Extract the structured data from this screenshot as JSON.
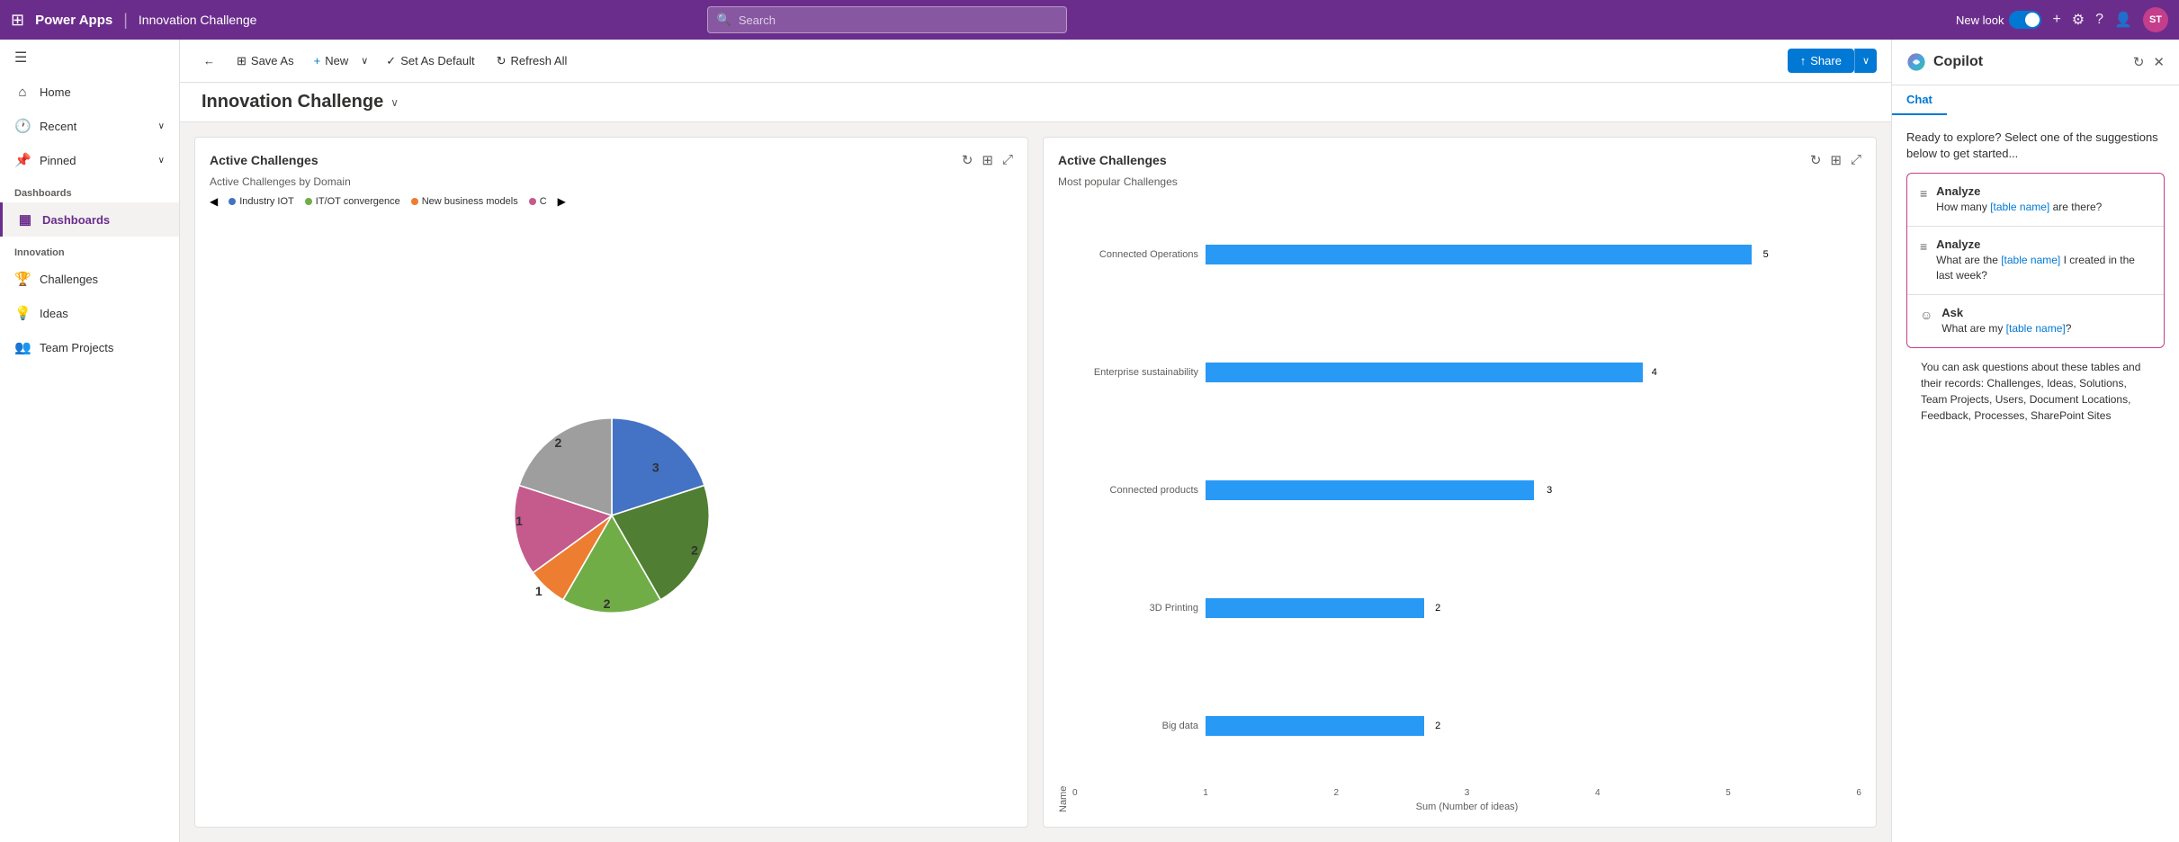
{
  "topNav": {
    "brand": "Power Apps",
    "divider": "|",
    "appName": "Innovation Challenge",
    "searchPlaceholder": "Search",
    "newLook": "New look",
    "icons": {
      "plus": "+",
      "settings": "⚙",
      "help": "?",
      "person": "👤"
    },
    "avatar": "ST"
  },
  "sidebar": {
    "hamburger": "☰",
    "items": [
      {
        "id": "home",
        "label": "Home",
        "icon": "⌂"
      },
      {
        "id": "recent",
        "label": "Recent",
        "icon": "🕐",
        "chevron": "∨"
      },
      {
        "id": "pinned",
        "label": "Pinned",
        "icon": "📌",
        "chevron": "∨"
      }
    ],
    "sections": [
      {
        "label": "Dashboards",
        "items": [
          {
            "id": "dashboards",
            "label": "Dashboards",
            "icon": "▦",
            "active": true
          }
        ]
      },
      {
        "label": "Innovation",
        "items": [
          {
            "id": "challenges",
            "label": "Challenges",
            "icon": "🏆"
          },
          {
            "id": "ideas",
            "label": "Ideas",
            "icon": "💡"
          },
          {
            "id": "team-projects",
            "label": "Team Projects",
            "icon": "👥"
          }
        ]
      }
    ]
  },
  "toolbar": {
    "back": "←",
    "saveAs": "Save As",
    "new": "New",
    "setAsDefault": "Set As Default",
    "refreshAll": "Refresh All",
    "share": "Share"
  },
  "pageTitle": "Innovation Challenge",
  "pieChart": {
    "title": "Active Challenges",
    "subtitle": "Active Challenges by Domain",
    "legend": [
      {
        "label": "Industry IOT",
        "color": "#4472c4"
      },
      {
        "label": "IT/OT convergence",
        "color": "#70ad47"
      },
      {
        "label": "New business models",
        "color": "#ed7d31"
      },
      {
        "label": "C",
        "color": "#c55a8c"
      }
    ],
    "slices": [
      {
        "label": "3",
        "color": "#4472c4",
        "value": 3,
        "startAngle": 0,
        "endAngle": 108
      },
      {
        "label": "2",
        "color": "#70ad47",
        "value": 2,
        "startAngle": 108,
        "endAngle": 216
      },
      {
        "label": "2",
        "color": "#70ad47",
        "value": 2,
        "startAngle": 108,
        "endAngle": 180
      },
      {
        "label": "1",
        "color": "#ed7d31",
        "value": 1,
        "startAngle": 216,
        "endAngle": 252
      },
      {
        "label": "1",
        "color": "#c55a8c",
        "value": 1,
        "startAngle": 252,
        "endAngle": 288
      },
      {
        "label": "2",
        "color": "#a5a5a5",
        "value": 2,
        "startAngle": 288,
        "endAngle": 360
      }
    ]
  },
  "barChart": {
    "title": "Active Challenges",
    "subtitle": "Most popular Challenges",
    "yAxisLabel": "Name",
    "xAxisLabel": "Sum (Number of ideas)",
    "maxValue": 6,
    "xAxisTicks": [
      "0",
      "1",
      "2",
      "3",
      "4",
      "5",
      "6"
    ],
    "bars": [
      {
        "label": "Connected Operations",
        "value": 5,
        "displayValue": "5"
      },
      {
        "label": "Enterprise sustainability",
        "value": 4,
        "displayValue": "4"
      },
      {
        "label": "Connected products",
        "value": 3,
        "displayValue": "3"
      },
      {
        "label": "3D Printing",
        "value": 2,
        "displayValue": "2"
      },
      {
        "label": "Big data",
        "value": 2,
        "displayValue": "2"
      }
    ]
  },
  "copilot": {
    "title": "Copilot",
    "tab": "Chat",
    "intro": "Ready to explore? Select one of the suggestions below to get started...",
    "suggestions": [
      {
        "id": "analyze1",
        "icon": "≡",
        "title": "Analyze",
        "textParts": [
          "How many ",
          "[table name]",
          " are there?"
        ],
        "linkIndex": 1
      },
      {
        "id": "analyze2",
        "icon": "≡",
        "title": "Analyze",
        "textParts": [
          "What are the ",
          "[table name]",
          " I created in the last week?"
        ],
        "linkIndex": 1
      },
      {
        "id": "ask1",
        "icon": "☺",
        "title": "Ask",
        "textParts": [
          "What are my ",
          "[table name]",
          "?"
        ],
        "linkIndex": 1
      }
    ],
    "footer": "You can ask questions about these tables and their records: Challenges, Ideas, Solutions, Team Projects, Users, Document Locations, Feedback, Processes, SharePoint Sites"
  }
}
